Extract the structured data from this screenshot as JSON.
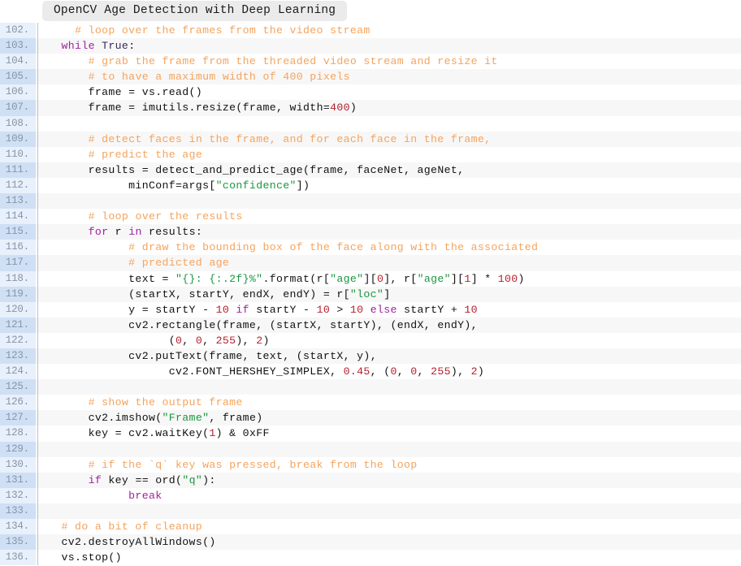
{
  "window": {
    "title": "OpenCV Age Detection with Deep Learning"
  },
  "colors": {
    "comment": "#f5a35c",
    "keyword": "#a020a0",
    "function": "#3a6ec4",
    "string": "#1a9641",
    "number": "#b5202d",
    "plain": "#111111",
    "gutter_text": "#8794a8",
    "gutter_bg_odd": "#e8f0fb",
    "gutter_bg_even": "#cfe0f5",
    "row_bg_odd": "#ffffff",
    "row_bg_even": "#f7f7f7",
    "title_chip_bg": "#ebebeb"
  },
  "editor": {
    "first_line": 102,
    "last_line": 136,
    "language": "python",
    "line_number_suffix": ".",
    "lines": [
      {
        "n": "102.",
        "tokens": [
          {
            "t": "    ",
            "c": "plain"
          },
          {
            "t": "# loop over the frames from the video stream",
            "c": "comment"
          }
        ]
      },
      {
        "n": "103.",
        "tokens": [
          {
            "t": "  ",
            "c": "plain"
          },
          {
            "t": "while",
            "c": "keyword"
          },
          {
            "t": " ",
            "c": "plain"
          },
          {
            "t": "True",
            "c": "const"
          },
          {
            "t": ":",
            "c": "plain"
          }
        ]
      },
      {
        "n": "104.",
        "tokens": [
          {
            "t": "      ",
            "c": "plain"
          },
          {
            "t": "# grab the frame from the threaded video stream and resize it",
            "c": "comment"
          }
        ]
      },
      {
        "n": "105.",
        "tokens": [
          {
            "t": "      ",
            "c": "plain"
          },
          {
            "t": "# to have a maximum width of 400 pixels",
            "c": "comment"
          }
        ]
      },
      {
        "n": "106.",
        "tokens": [
          {
            "t": "      frame = vs.",
            "c": "plain"
          },
          {
            "t": "read",
            "c": "function"
          },
          {
            "t": "()",
            "c": "plain"
          }
        ]
      },
      {
        "n": "107.",
        "tokens": [
          {
            "t": "      frame = imutils.",
            "c": "plain"
          },
          {
            "t": "resize",
            "c": "function"
          },
          {
            "t": "(frame, width=",
            "c": "plain"
          },
          {
            "t": "400",
            "c": "number"
          },
          {
            "t": ")",
            "c": "plain"
          }
        ]
      },
      {
        "n": "108.",
        "tokens": []
      },
      {
        "n": "109.",
        "tokens": [
          {
            "t": "      ",
            "c": "plain"
          },
          {
            "t": "# detect faces in the frame, and for each face in the frame,",
            "c": "comment"
          }
        ]
      },
      {
        "n": "110.",
        "tokens": [
          {
            "t": "      ",
            "c": "plain"
          },
          {
            "t": "# predict the age",
            "c": "comment"
          }
        ]
      },
      {
        "n": "111.",
        "tokens": [
          {
            "t": "      results = ",
            "c": "plain"
          },
          {
            "t": "detect_and_predict_age",
            "c": "function"
          },
          {
            "t": "(frame, faceNet, ageNet,",
            "c": "plain"
          }
        ]
      },
      {
        "n": "112.",
        "tokens": [
          {
            "t": "            minConf=args[",
            "c": "plain"
          },
          {
            "t": "\"confidence\"",
            "c": "string"
          },
          {
            "t": "])",
            "c": "plain"
          }
        ]
      },
      {
        "n": "113.",
        "tokens": []
      },
      {
        "n": "114.",
        "tokens": [
          {
            "t": "      ",
            "c": "plain"
          },
          {
            "t": "# loop over the results",
            "c": "comment"
          }
        ]
      },
      {
        "n": "115.",
        "tokens": [
          {
            "t": "      ",
            "c": "plain"
          },
          {
            "t": "for",
            "c": "keyword"
          },
          {
            "t": " r ",
            "c": "plain"
          },
          {
            "t": "in",
            "c": "keyword"
          },
          {
            "t": " results:",
            "c": "plain"
          }
        ]
      },
      {
        "n": "116.",
        "tokens": [
          {
            "t": "            ",
            "c": "plain"
          },
          {
            "t": "# draw the bounding box of the face along with the associated",
            "c": "comment"
          }
        ]
      },
      {
        "n": "117.",
        "tokens": [
          {
            "t": "            ",
            "c": "plain"
          },
          {
            "t": "# predicted age",
            "c": "comment"
          }
        ]
      },
      {
        "n": "118.",
        "tokens": [
          {
            "t": "            text = ",
            "c": "plain"
          },
          {
            "t": "\"{}: {:.2f}%\"",
            "c": "string"
          },
          {
            "t": ".",
            "c": "plain"
          },
          {
            "t": "format",
            "c": "function"
          },
          {
            "t": "(r[",
            "c": "plain"
          },
          {
            "t": "\"age\"",
            "c": "string"
          },
          {
            "t": "][",
            "c": "plain"
          },
          {
            "t": "0",
            "c": "number"
          },
          {
            "t": "], r[",
            "c": "plain"
          },
          {
            "t": "\"age\"",
            "c": "string"
          },
          {
            "t": "][",
            "c": "plain"
          },
          {
            "t": "1",
            "c": "number"
          },
          {
            "t": "] * ",
            "c": "plain"
          },
          {
            "t": "100",
            "c": "number"
          },
          {
            "t": ")",
            "c": "plain"
          }
        ]
      },
      {
        "n": "119.",
        "tokens": [
          {
            "t": "            (startX, startY, endX, endY) = r[",
            "c": "plain"
          },
          {
            "t": "\"loc\"",
            "c": "string"
          },
          {
            "t": "]",
            "c": "plain"
          }
        ]
      },
      {
        "n": "120.",
        "tokens": [
          {
            "t": "            y = startY - ",
            "c": "plain"
          },
          {
            "t": "10",
            "c": "number"
          },
          {
            "t": " ",
            "c": "plain"
          },
          {
            "t": "if",
            "c": "keyword"
          },
          {
            "t": " startY - ",
            "c": "plain"
          },
          {
            "t": "10",
            "c": "number"
          },
          {
            "t": " > ",
            "c": "plain"
          },
          {
            "t": "10",
            "c": "number"
          },
          {
            "t": " ",
            "c": "plain"
          },
          {
            "t": "else",
            "c": "keyword"
          },
          {
            "t": " startY + ",
            "c": "plain"
          },
          {
            "t": "10",
            "c": "number"
          }
        ]
      },
      {
        "n": "121.",
        "tokens": [
          {
            "t": "            cv2.",
            "c": "plain"
          },
          {
            "t": "rectangle",
            "c": "function"
          },
          {
            "t": "(frame, (startX, startY), (endX, endY),",
            "c": "plain"
          }
        ]
      },
      {
        "n": "122.",
        "tokens": [
          {
            "t": "                  (",
            "c": "plain"
          },
          {
            "t": "0",
            "c": "number"
          },
          {
            "t": ", ",
            "c": "plain"
          },
          {
            "t": "0",
            "c": "number"
          },
          {
            "t": ", ",
            "c": "plain"
          },
          {
            "t": "255",
            "c": "number"
          },
          {
            "t": "), ",
            "c": "plain"
          },
          {
            "t": "2",
            "c": "number"
          },
          {
            "t": ")",
            "c": "plain"
          }
        ]
      },
      {
        "n": "123.",
        "tokens": [
          {
            "t": "            cv2.",
            "c": "plain"
          },
          {
            "t": "putText",
            "c": "function"
          },
          {
            "t": "(frame, text, (startX, y),",
            "c": "plain"
          }
        ]
      },
      {
        "n": "124.",
        "tokens": [
          {
            "t": "                  cv2.FONT_HERSHEY_SIMPLEX, ",
            "c": "plain"
          },
          {
            "t": "0.45",
            "c": "number"
          },
          {
            "t": ", (",
            "c": "plain"
          },
          {
            "t": "0",
            "c": "number"
          },
          {
            "t": ", ",
            "c": "plain"
          },
          {
            "t": "0",
            "c": "number"
          },
          {
            "t": ", ",
            "c": "plain"
          },
          {
            "t": "255",
            "c": "number"
          },
          {
            "t": "), ",
            "c": "plain"
          },
          {
            "t": "2",
            "c": "number"
          },
          {
            "t": ")",
            "c": "plain"
          }
        ]
      },
      {
        "n": "125.",
        "tokens": []
      },
      {
        "n": "126.",
        "tokens": [
          {
            "t": "      ",
            "c": "plain"
          },
          {
            "t": "# show the output frame",
            "c": "comment"
          }
        ]
      },
      {
        "n": "127.",
        "tokens": [
          {
            "t": "      cv2.",
            "c": "plain"
          },
          {
            "t": "imshow",
            "c": "function"
          },
          {
            "t": "(",
            "c": "plain"
          },
          {
            "t": "\"Frame\"",
            "c": "string"
          },
          {
            "t": ", frame)",
            "c": "plain"
          }
        ]
      },
      {
        "n": "128.",
        "tokens": [
          {
            "t": "      key = cv2.",
            "c": "plain"
          },
          {
            "t": "waitKey",
            "c": "function"
          },
          {
            "t": "(",
            "c": "plain"
          },
          {
            "t": "1",
            "c": "number"
          },
          {
            "t": ") & 0xFF",
            "c": "plain"
          }
        ]
      },
      {
        "n": "129.",
        "tokens": []
      },
      {
        "n": "130.",
        "tokens": [
          {
            "t": "      ",
            "c": "plain"
          },
          {
            "t": "# if the `q` key was pressed, break from the loop",
            "c": "comment"
          }
        ]
      },
      {
        "n": "131.",
        "tokens": [
          {
            "t": "      ",
            "c": "plain"
          },
          {
            "t": "if",
            "c": "keyword"
          },
          {
            "t": " key == ",
            "c": "plain"
          },
          {
            "t": "ord",
            "c": "function"
          },
          {
            "t": "(",
            "c": "plain"
          },
          {
            "t": "\"q\"",
            "c": "string"
          },
          {
            "t": "):",
            "c": "plain"
          }
        ]
      },
      {
        "n": "132.",
        "tokens": [
          {
            "t": "            ",
            "c": "plain"
          },
          {
            "t": "break",
            "c": "keyword"
          }
        ]
      },
      {
        "n": "133.",
        "tokens": []
      },
      {
        "n": "134.",
        "tokens": [
          {
            "t": "  ",
            "c": "plain"
          },
          {
            "t": "# do a bit of cleanup",
            "c": "comment"
          }
        ]
      },
      {
        "n": "135.",
        "tokens": [
          {
            "t": "  cv2.",
            "c": "plain"
          },
          {
            "t": "destroyAllWindows",
            "c": "function"
          },
          {
            "t": "()",
            "c": "plain"
          }
        ]
      },
      {
        "n": "136.",
        "tokens": [
          {
            "t": "  vs.",
            "c": "plain"
          },
          {
            "t": "stop",
            "c": "function"
          },
          {
            "t": "()",
            "c": "plain"
          }
        ]
      }
    ]
  }
}
